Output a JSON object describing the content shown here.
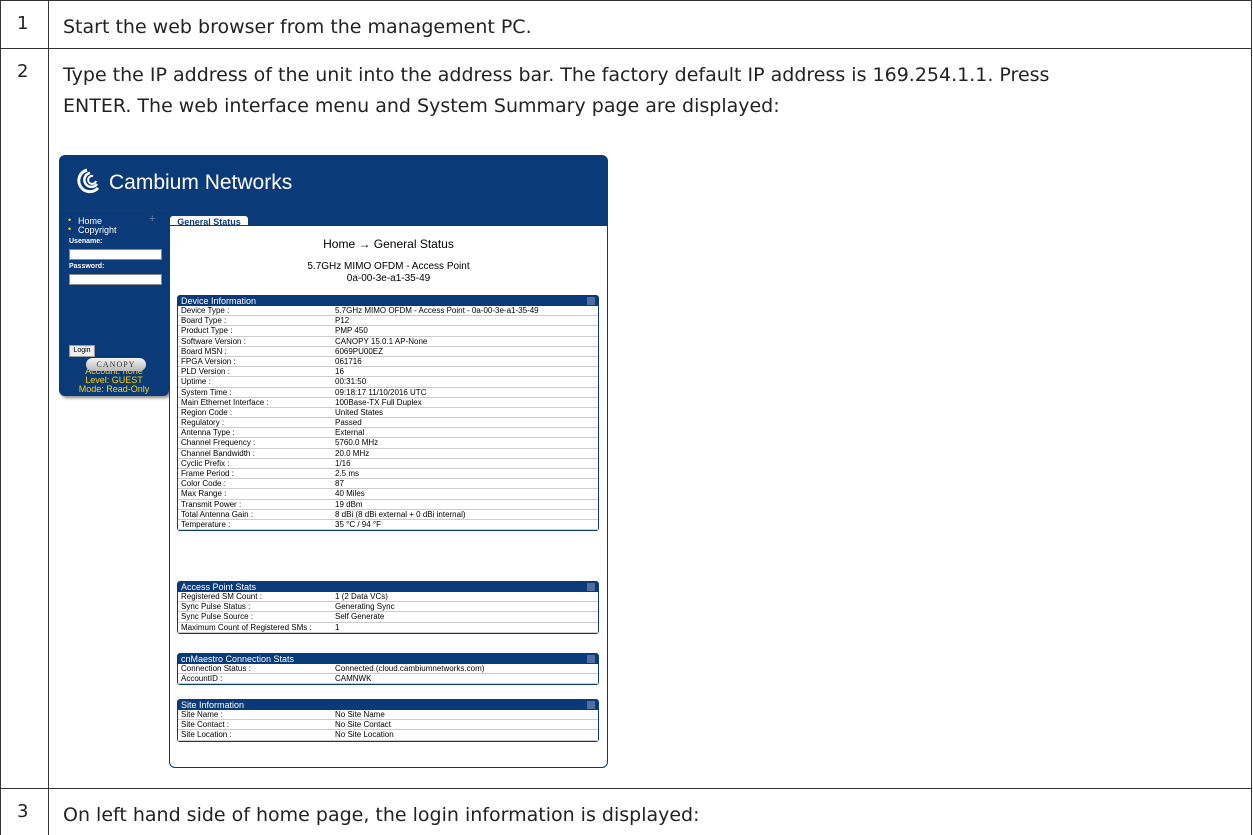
{
  "steps": [
    {
      "num": "1",
      "text": "Start the web browser from the management PC."
    },
    {
      "num": "2",
      "text_line1": "Type the IP address of the unit into the address bar. The factory default IP address is 169.254.1.1. Press",
      "text_line2": "ENTER. The web interface menu and System Summary page are displayed:"
    },
    {
      "num": "3",
      "text": "On left hand side of home page, the login information is displayed:"
    }
  ],
  "screenshot": {
    "brand": "Cambium Networks",
    "brand_color": "#0b3a78",
    "nav": {
      "home": "Home",
      "copyright": "Copyright"
    },
    "username_label": "Usename:",
    "password_label": "Password:",
    "login_button": "Login",
    "account": "Account: none",
    "level": "Level: GUEST",
    "mode": "Mode: Read-Only",
    "canopy": "CANOPY",
    "tab": "General Status",
    "breadcrumb": "Home → General Status",
    "device_title": "5.7GHz MIMO OFDM - Access Point",
    "device_mac": "0a-00-3e-a1-35-49",
    "device_info": {
      "title": "Device Information",
      "rows": [
        [
          "Device Type :",
          "5.7GHz MIMO OFDM - Access Point - 0a-00-3e-a1-35-49"
        ],
        [
          "Board Type :",
          "P12"
        ],
        [
          "Product Type :",
          "PMP 450"
        ],
        [
          "Software Version :",
          "CANOPY 15.0.1 AP-None"
        ],
        [
          "Board MSN :",
          "6069PU00EZ"
        ],
        [
          "FPGA Version :",
          "061716"
        ],
        [
          "PLD Version :",
          "16"
        ],
        [
          "Uptime :",
          "00:31:50"
        ],
        [
          "System Time :",
          "09:18:17 11/10/2016 UTC"
        ],
        [
          "Main Ethernet Interface :",
          "100Base-TX Full Duplex"
        ],
        [
          "Region Code :",
          "United States"
        ],
        [
          "Regulatory :",
          "Passed"
        ],
        [
          "Antenna Type :",
          "External"
        ],
        [
          "Channel Frequency :",
          "5760.0 MHz"
        ],
        [
          "Channel Bandwidth :",
          "20.0 MHz"
        ],
        [
          "Cyclic Prefix :",
          "1/16"
        ],
        [
          "Frame Period :",
          "2.5 ms"
        ],
        [
          "Color Code :",
          "87"
        ],
        [
          "Max Range :",
          "40 Miles"
        ],
        [
          "Transmit Power :",
          "19 dBm"
        ],
        [
          "Total Antenna Gain :",
          "8 dBi (8 dBi external + 0 dBi internal)"
        ],
        [
          "Temperature :",
          "35 °C / 94 °F"
        ]
      ]
    },
    "ap_stats": {
      "title": "Access Point Stats",
      "rows": [
        [
          "Registered SM Count :",
          "1 (2 Data VCs)"
        ],
        [
          "Sync Pulse Status :",
          "Generating Sync"
        ],
        [
          "Sync Pulse Source :",
          "Self Generate"
        ],
        [
          "Maximum Count of Registered SMs :",
          "1"
        ]
      ]
    },
    "cnmaestro": {
      "title": "cnMaestro Connection Stats",
      "rows": [
        [
          "Connection Status :",
          "Connected (cloud.cambiumnetworks.com)"
        ],
        [
          "AccountID :",
          "CAMNWK"
        ]
      ]
    },
    "site": {
      "title": "Site Information",
      "rows": [
        [
          "Site Name :",
          "No Site Name"
        ],
        [
          "Site Contact :",
          "No Site Contact"
        ],
        [
          "Site Location :",
          "No Site Location"
        ]
      ]
    }
  }
}
